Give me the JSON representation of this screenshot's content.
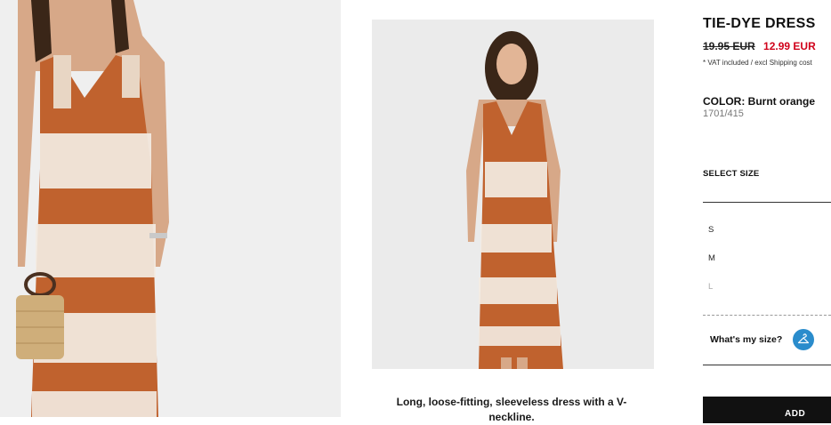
{
  "product": {
    "title": "TIE-DYE DRESS",
    "old_price": "19.95 EUR",
    "new_price": "12.99 EUR",
    "vat_note": "* VAT included / excl Shipping cost",
    "color_label": "COLOR: Burnt orange",
    "sku": "1701/415",
    "description": "Long, loose-fitting, sleeveless dress with a V-neckline."
  },
  "size": {
    "select_label": "SELECT SIZE",
    "options": [
      "S",
      "M",
      "L"
    ],
    "whats_my_size": "What's my size?"
  },
  "actions": {
    "add_label": "ADD"
  },
  "colors": {
    "dress": "#c0622e",
    "sale_red": "#d0021b",
    "hanger_blue": "#2a8ccc"
  }
}
